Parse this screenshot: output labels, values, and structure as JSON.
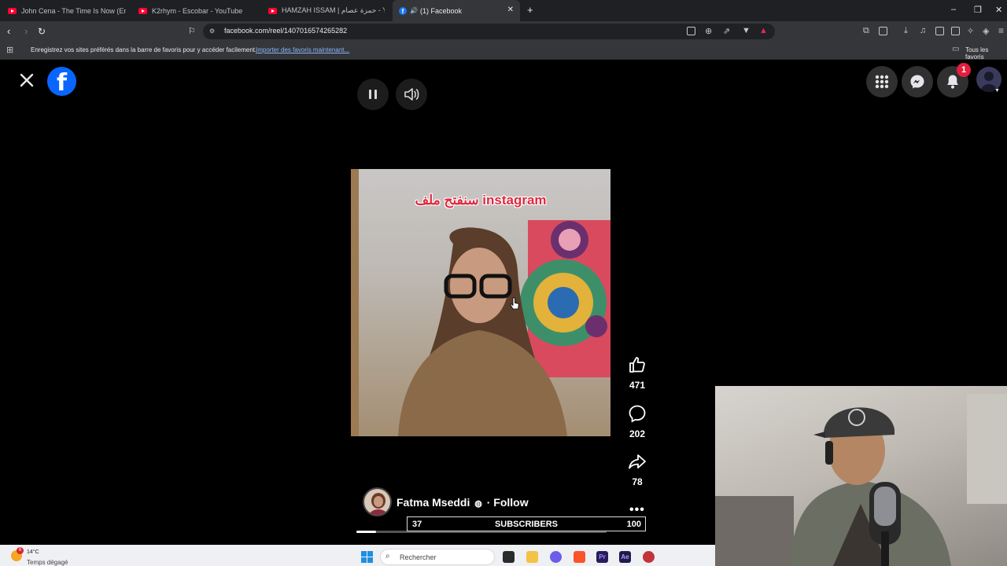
{
  "browser": {
    "tabs": [
      {
        "title": "John Cena - The Time Is Now (Entran",
        "icon": "youtube-icon"
      },
      {
        "title": "K2rhym - Escobar - YouTube",
        "icon": "youtube-icon"
      },
      {
        "title": "HAMZAH ISSAM | حمزة عصام - YouTu",
        "icon": "youtube-icon"
      },
      {
        "title": "(1) Facebook",
        "icon": "facebook-icon",
        "active": true
      }
    ],
    "url": "facebook.com/reel/1407016574265282",
    "bookmarks_prompt": "Enregistrez vos sites préférés dans la barre de favoris pour y accéder facilement.",
    "bookmarks_import_link": "Importer des favoris maintenant...",
    "all_bookmarks": "Tous les favoris"
  },
  "facebook": {
    "notification_count": "1",
    "reel": {
      "video_caption": "سنفتح ملف instagram",
      "likes": "471",
      "comments": "202",
      "shares": "78",
      "author": "Fatma Mseddi",
      "follow_label": "· Follow",
      "progress_fraction": 0.08
    }
  },
  "overlay": {
    "subscribers_current": "37",
    "subscribers_label": "SUBSCRIBERS",
    "subscribers_goal": "100"
  },
  "taskbar": {
    "weather_temp": "14°C",
    "weather_desc": "Temps dégagé",
    "weather_badge": "6",
    "search_placeholder": "Rechercher"
  },
  "colors": {
    "facebook_blue": "#0866ff",
    "badge_red": "#e41e3f",
    "caption_red": "#e0283f"
  }
}
